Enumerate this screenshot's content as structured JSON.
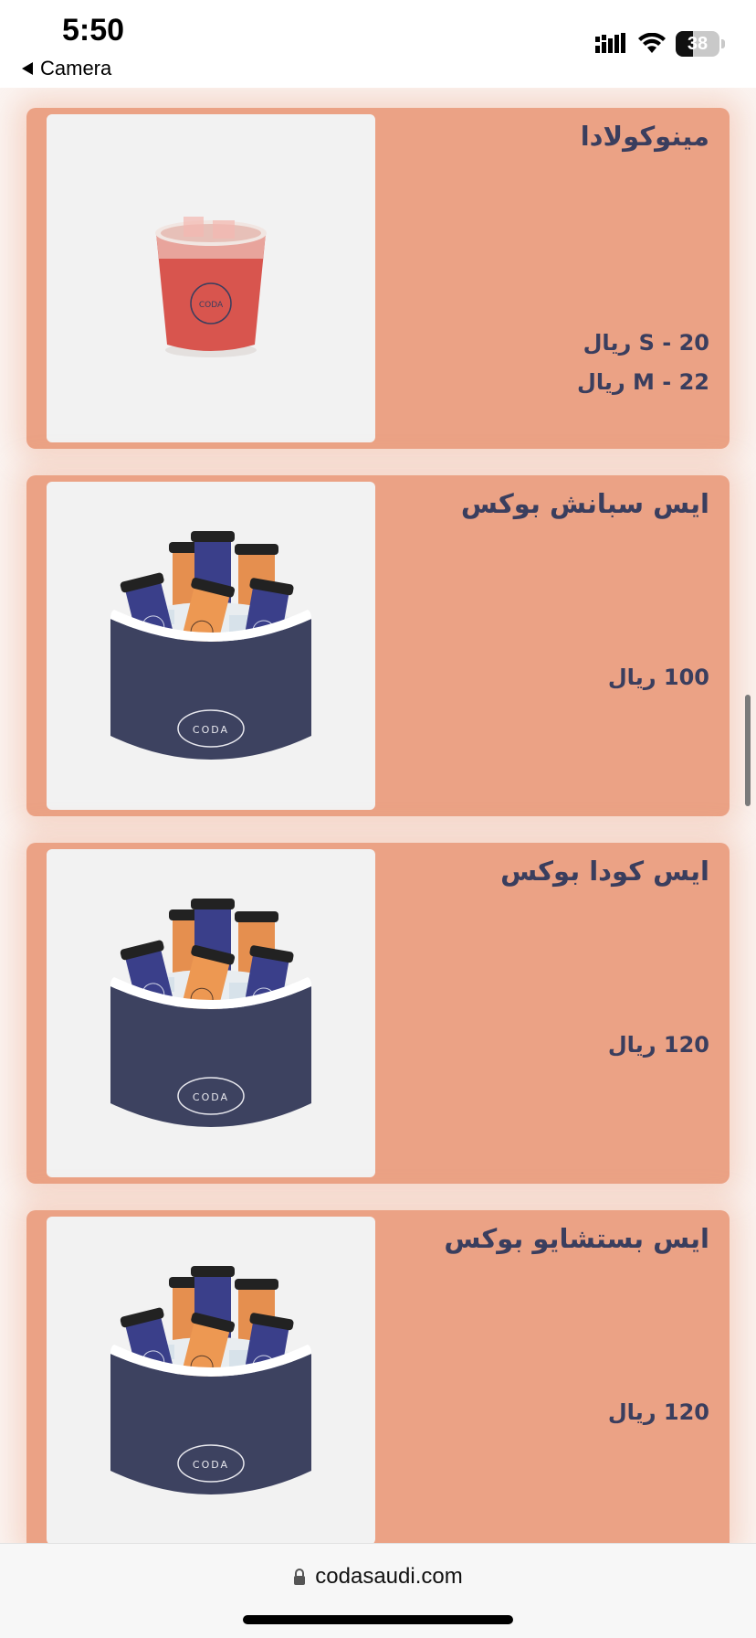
{
  "status_bar": {
    "time": "5:50",
    "back_app": "Camera",
    "battery": "38",
    "icons": [
      "cellular-signal-icon",
      "wifi-icon",
      "battery-icon"
    ]
  },
  "menu": {
    "items": [
      {
        "name": "مينوكولادا",
        "prices": [
          "S - 20 ريال",
          "M - 22 ريال"
        ],
        "image": "red-iced-drink-cup"
      },
      {
        "name": "ايس سبانش بوكس",
        "prices": [
          "100 ريال"
        ],
        "image": "coda-ice-bucket-box"
      },
      {
        "name": "ايس كودا بوكس",
        "prices": [
          "120 ريال"
        ],
        "image": "coda-ice-bucket-box"
      },
      {
        "name": "ايس بستشايو بوكس",
        "prices": [
          "120 ريال"
        ],
        "image": "coda-ice-bucket-box"
      }
    ]
  },
  "browser": {
    "url": "codasaudi.com"
  },
  "colors": {
    "card_bg": "#eba285",
    "text": "#3a3e5e",
    "bucket": "#3d4260"
  }
}
